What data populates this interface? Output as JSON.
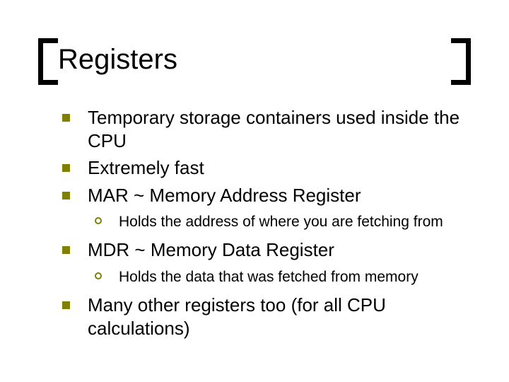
{
  "title": "Registers",
  "bullets": [
    {
      "text": "Temporary storage containers used inside the CPU"
    },
    {
      "text": "Extremely fast"
    },
    {
      "text": "MAR ~ Memory Address Register",
      "sub": [
        {
          "text": "Holds the address of where you are fetching from"
        }
      ]
    },
    {
      "text": "MDR ~ Memory Data Register",
      "sub": [
        {
          "text": "Holds the data that was fetched from memory"
        }
      ]
    },
    {
      "text": "Many other registers too (for all CPU calculations)"
    }
  ],
  "colors": {
    "bullet": "#808000"
  }
}
